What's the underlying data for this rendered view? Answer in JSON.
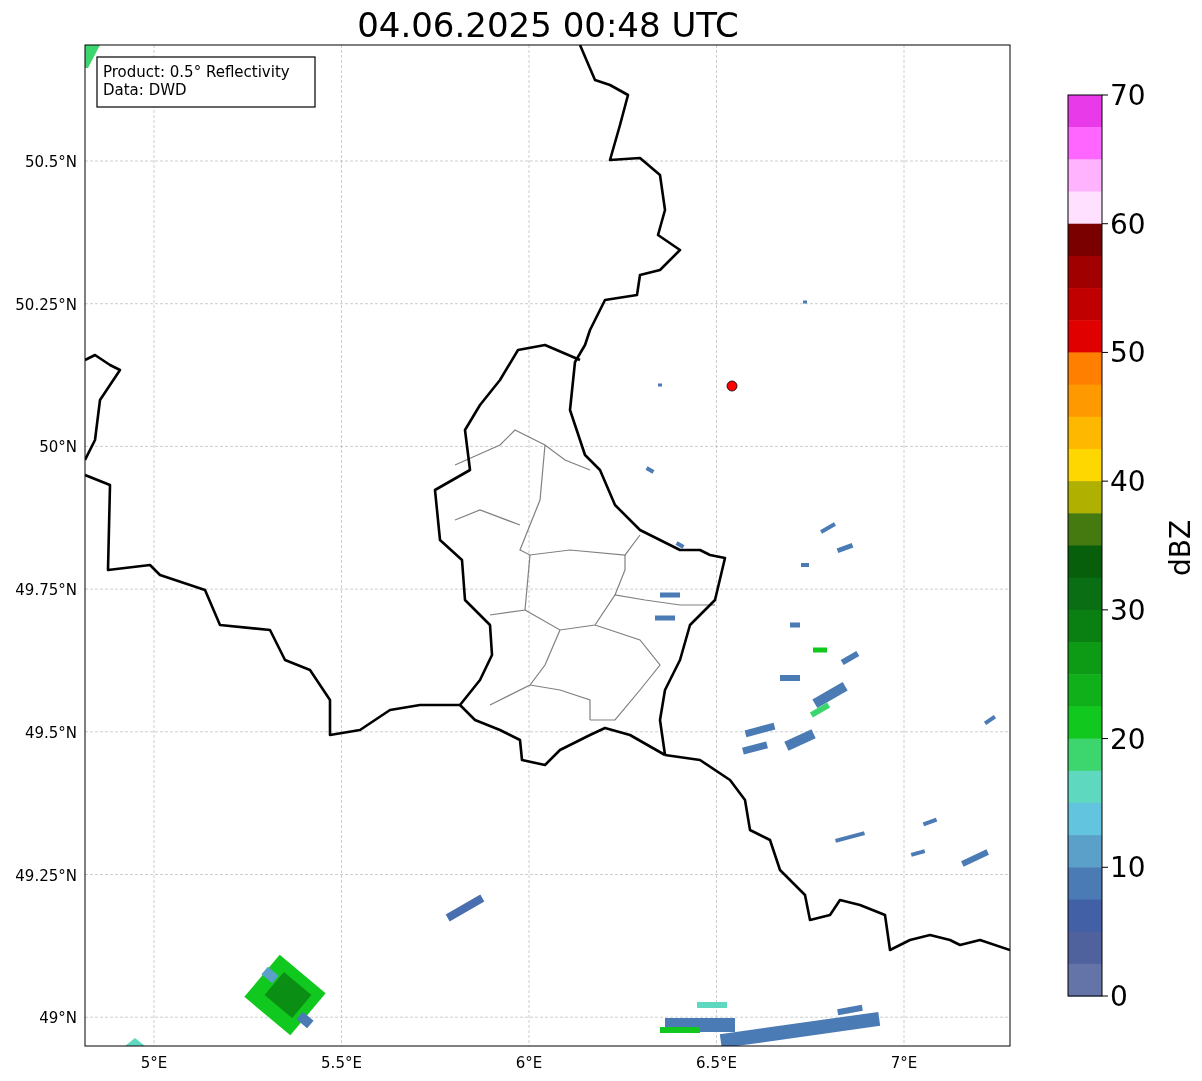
{
  "title": "04.06.2025 00:48 UTC",
  "info_box": {
    "lines": [
      "Product: 0.5° Reflectivity",
      "Data: DWD"
    ]
  },
  "map": {
    "lon_ticks": [
      "5°E",
      "5.5°E",
      "6°E",
      "6.5°E",
      "7°E"
    ],
    "lat_ticks": [
      "50.5°N",
      "50.25°N",
      "50°N",
      "49.75°N",
      "49.5°N",
      "49.25°N",
      "49°N"
    ]
  },
  "colorbar": {
    "label": "dBZ",
    "ticks": [
      "70",
      "60",
      "50",
      "40",
      "30",
      "20",
      "10",
      "0"
    ],
    "bins": [
      {
        "color": "#e83ae8"
      },
      {
        "color": "#ff66ff"
      },
      {
        "color": "#ffb3ff"
      },
      {
        "color": "#ffe0ff"
      },
      {
        "color": "#7a0000"
      },
      {
        "color": "#a00000"
      },
      {
        "color": "#c00000"
      },
      {
        "color": "#e00000"
      },
      {
        "color": "#ff7f00"
      },
      {
        "color": "#ff9900"
      },
      {
        "color": "#ffb800"
      },
      {
        "color": "#ffd700"
      },
      {
        "color": "#b0b000"
      },
      {
        "color": "#457a10"
      },
      {
        "color": "#075e0b"
      },
      {
        "color": "#0a6e14"
      },
      {
        "color": "#0b8012"
      },
      {
        "color": "#0d9a14"
      },
      {
        "color": "#0fb01a"
      },
      {
        "color": "#11c81e"
      },
      {
        "color": "#3dd66e"
      },
      {
        "color": "#5fd8c0"
      },
      {
        "color": "#62c4de"
      },
      {
        "color": "#5aa0c8"
      },
      {
        "color": "#4a7bb4"
      },
      {
        "color": "#4260a6"
      },
      {
        "color": "#50629e"
      },
      {
        "color": "#6474a8"
      }
    ]
  }
}
